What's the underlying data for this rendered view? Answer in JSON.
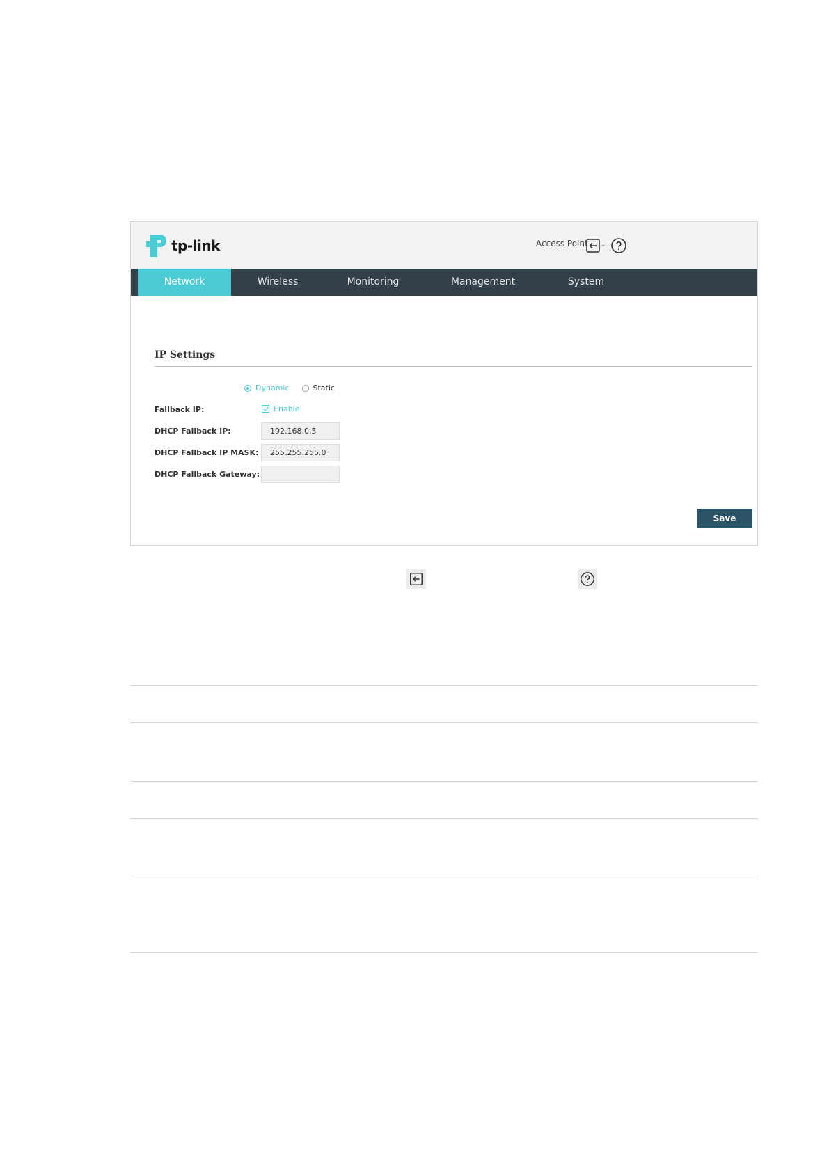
{
  "header": {
    "logo_text": "tp-link",
    "mode_label": "Access Point",
    "logout_icon": "logout-icon",
    "help_icon": "help-icon"
  },
  "nav": {
    "items": [
      {
        "label": "Network",
        "active": true
      },
      {
        "label": "Wireless",
        "active": false
      },
      {
        "label": "Monitoring",
        "active": false
      },
      {
        "label": "Management",
        "active": false
      },
      {
        "label": "System",
        "active": false
      }
    ]
  },
  "ip_settings": {
    "title": "IP Settings",
    "mode_options": [
      {
        "label": "Dynamic",
        "selected": true
      },
      {
        "label": "Static",
        "selected": false
      }
    ],
    "fallback_ip": {
      "label": "Fallback IP:",
      "checkbox_label": "Enable",
      "checked": true
    },
    "dhcp_fallback_ip": {
      "label": "DHCP Fallback IP:",
      "value": "192.168.0.5"
    },
    "dhcp_fallback_mask": {
      "label": "DHCP Fallback IP MASK:",
      "value": "255.255.255.0"
    },
    "dhcp_fallback_gateway": {
      "label": "DHCP Fallback Gateway:",
      "value": ""
    },
    "save_label": "Save"
  },
  "colors": {
    "accent": "#4acbd6",
    "nav_bg": "#313f48",
    "save_bg": "#2b5466",
    "topbar_bg": "#f2f2f2"
  }
}
